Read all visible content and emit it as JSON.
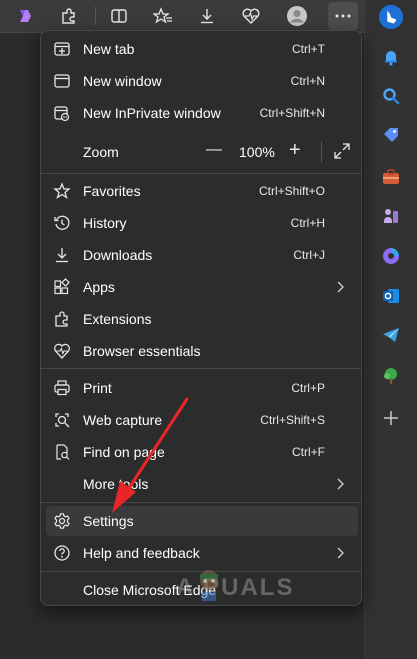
{
  "menu": {
    "items": [
      {
        "label": "New tab",
        "shortcut": "Ctrl+T"
      },
      {
        "label": "New window",
        "shortcut": "Ctrl+N"
      },
      {
        "label": "New InPrivate window",
        "shortcut": "Ctrl+Shift+N"
      },
      {
        "label": "Favorites",
        "shortcut": "Ctrl+Shift+O"
      },
      {
        "label": "History",
        "shortcut": "Ctrl+H"
      },
      {
        "label": "Downloads",
        "shortcut": "Ctrl+J"
      },
      {
        "label": "Apps",
        "shortcut": ""
      },
      {
        "label": "Extensions",
        "shortcut": ""
      },
      {
        "label": "Browser essentials",
        "shortcut": ""
      },
      {
        "label": "Print",
        "shortcut": "Ctrl+P"
      },
      {
        "label": "Web capture",
        "shortcut": "Ctrl+Shift+S"
      },
      {
        "label": "Find on page",
        "shortcut": "Ctrl+F"
      },
      {
        "label": "More tools",
        "shortcut": ""
      },
      {
        "label": "Settings",
        "shortcut": ""
      },
      {
        "label": "Help and feedback",
        "shortcut": ""
      },
      {
        "label": "Close Microsoft Edge",
        "shortcut": ""
      }
    ],
    "zoom": {
      "label": "Zoom",
      "minus": "—",
      "value": "100%",
      "plus": "+"
    }
  },
  "watermark": {
    "text": "A  PUALS"
  },
  "colors": {
    "accent": "#1a73e8",
    "arrow": "#e8262a",
    "menu_bg": "#2c2c2c",
    "toolbar_bg": "#3b3b3b"
  },
  "icons": {
    "toolbar": [
      "copilot-icon",
      "extensions-icon",
      "split-screen-icon",
      "favorites-icon",
      "downloads-icon",
      "browser-essentials-icon",
      "profile-icon",
      "more-icon"
    ],
    "sidebar": [
      "bing-icon",
      "notifications-icon",
      "search-icon",
      "shopping-icon",
      "tools-icon",
      "games-icon",
      "microsoft365-icon",
      "outlook-icon",
      "telegram-icon",
      "tree-icon",
      "add-icon"
    ]
  }
}
